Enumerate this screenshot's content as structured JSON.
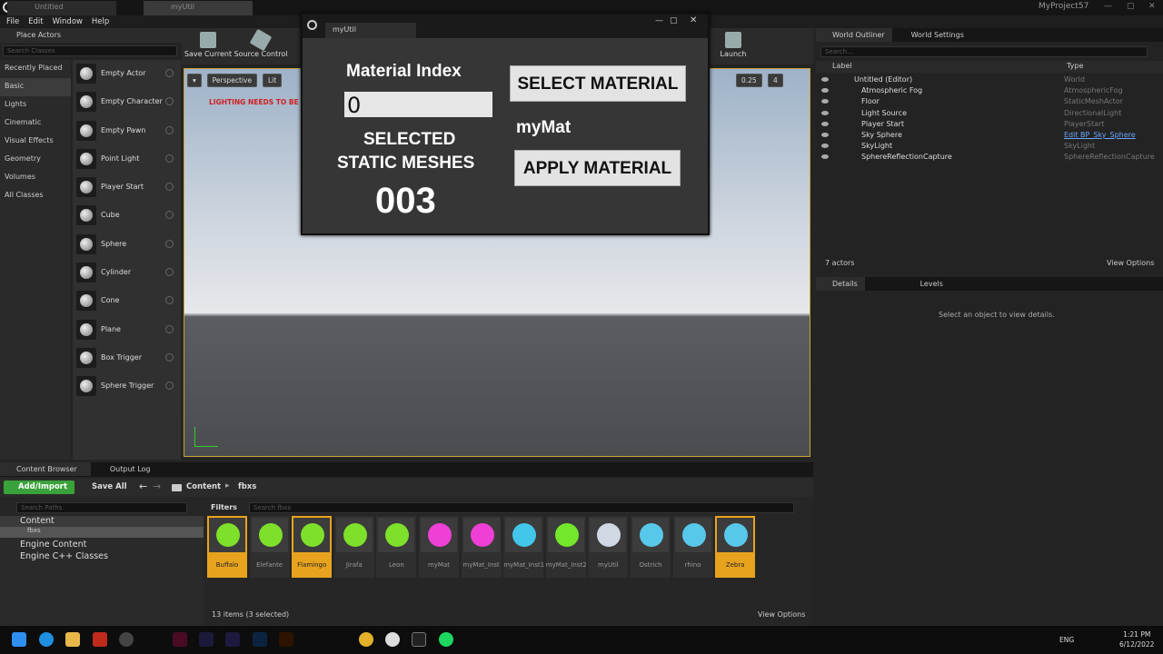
{
  "window": {
    "tabs": [
      "Untitled",
      "myUtil"
    ],
    "project": "MyProject57"
  },
  "menu": [
    "File",
    "Edit",
    "Window",
    "Help"
  ],
  "place_actors": {
    "title": "Place Actors",
    "search_placeholder": "Search Classes",
    "categories": [
      "Recently Placed",
      "Basic",
      "Lights",
      "Cinematic",
      "Visual Effects",
      "Geometry",
      "Volumes",
      "All Classes"
    ],
    "items": [
      "Empty Actor",
      "Empty Character",
      "Empty Pawn",
      "Point Light",
      "Player Start",
      "Cube",
      "Sphere",
      "Cylinder",
      "Cone",
      "Plane",
      "Box Trigger",
      "Sphere Trigger"
    ]
  },
  "toolbar": {
    "save": "Save Current",
    "source": "Source Control",
    "launch": "Launch"
  },
  "viewport": {
    "perspective": "Perspective",
    "lit": "Lit",
    "warning": "LIGHTING NEEDS TO BE R",
    "scale": "0.25",
    "cam": "4"
  },
  "util": {
    "tab": "myUtil",
    "material_index_label": "Material Index",
    "material_index_value": "0",
    "selected_label_1": "SELECTED",
    "selected_label_2": "STATIC MESHES",
    "count": "003",
    "select_button": "SELECT MATERIAL",
    "material_name": "myMat",
    "apply_button": "APPLY MATERIAL"
  },
  "outliner": {
    "tabs": [
      "World Outliner",
      "World Settings"
    ],
    "search_placeholder": "Search...",
    "col_label": "Label",
    "col_type": "Type",
    "rows": [
      {
        "label": "Untitled (Editor)",
        "type": "World"
      },
      {
        "label": "Atmospheric Fog",
        "type": "AtmosphericFog"
      },
      {
        "label": "Floor",
        "type": "StaticMeshActor"
      },
      {
        "label": "Light Source",
        "type": "DirectionalLight"
      },
      {
        "label": "Player Start",
        "type": "PlayerStart"
      },
      {
        "label": "Sky Sphere",
        "type": "Edit BP_Sky_Sphere"
      },
      {
        "label": "SkyLight",
        "type": "SkyLight"
      },
      {
        "label": "SphereReflectionCapture",
        "type": "SphereReflectionCapture"
      }
    ],
    "count": "7 actors",
    "view_options": "View Options"
  },
  "details": {
    "tabs": [
      "Details",
      "Levels"
    ],
    "empty": "Select an object to view details."
  },
  "content_browser": {
    "tabs": [
      "Content Browser",
      "Output Log"
    ],
    "add_import": "Add/Import",
    "save_all": "Save All",
    "path": [
      "Content",
      "fbxs"
    ],
    "search_paths": "Search Paths",
    "filters": "Filters",
    "search_fbxs": "Search fbxs",
    "tree": [
      "Content",
      "fbxs",
      "Engine Content",
      "Engine C++ Classes"
    ],
    "assets": [
      {
        "name": "Buffalo",
        "sel": true,
        "color": "#7ee02a"
      },
      {
        "name": "Elefante",
        "sel": false,
        "color": "#7ee02a"
      },
      {
        "name": "Flamingo",
        "sel": true,
        "color": "#7ee02a"
      },
      {
        "name": "Jirafa",
        "sel": false,
        "color": "#7ee02a"
      },
      {
        "name": "Leon",
        "sel": false,
        "color": "#7ee02a"
      },
      {
        "name": "myMat",
        "sel": false,
        "color": "#ee3fd6"
      },
      {
        "name": "myMat_Inst",
        "sel": false,
        "color": "#ee3fd6"
      },
      {
        "name": "myMat_Inst1",
        "sel": false,
        "color": "#42c6ea"
      },
      {
        "name": "myMat_Inst2",
        "sel": false,
        "color": "#74e62b"
      },
      {
        "name": "myUtil",
        "sel": false,
        "color": "#cfd8e3"
      },
      {
        "name": "Ostrich",
        "sel": false,
        "color": "#58c8ea"
      },
      {
        "name": "rhino",
        "sel": false,
        "color": "#58c8ea"
      },
      {
        "name": "Zebra",
        "sel": true,
        "color": "#58c8ea"
      }
    ],
    "status": "13 items (3 selected)",
    "view_options": "View Options"
  },
  "taskbar": {
    "lang": "ENG",
    "time": "1:21 PM",
    "date": "6/12/2022"
  }
}
